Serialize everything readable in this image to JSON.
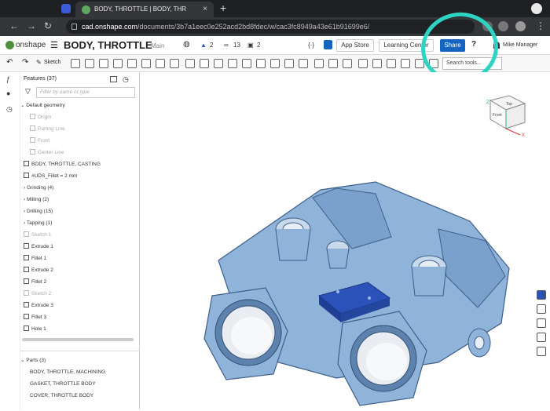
{
  "browser": {
    "tab_title": "BODY, THROTTLE | BODY, THR",
    "tab_close": "×",
    "new_tab": "+",
    "url_host": "cad.onshape.com",
    "url_path": "/documents/3b7a1eec0e252acd2bd8fdec/w/cac3fc8949a43e61b91699e6/"
  },
  "header": {
    "brand": "onshape",
    "doc_title": "BODY, THROTTLE",
    "branch": "Main",
    "likes": "2",
    "links": "13",
    "copies": "2",
    "app_store": "App Store",
    "learning_center": "Learning Center",
    "share": "Share",
    "help": "?",
    "user": "Mike Manager"
  },
  "toolbar": {
    "sketch_label": "Sketch",
    "search_tools": "Search tools..."
  },
  "features": {
    "header": "Features (37)",
    "filter_placeholder": "Filter by name or type",
    "default_geometry": "Default geometry",
    "items": [
      {
        "label": "Origin",
        "state": "dim",
        "indent": 2
      },
      {
        "label": "Parting Line",
        "state": "dim",
        "indent": 2
      },
      {
        "label": "Front",
        "state": "dim",
        "indent": 2
      },
      {
        "label": "Center Line",
        "state": "dim",
        "indent": 2
      },
      {
        "label": "BODY, THROTTLE, CASTING",
        "state": "normal",
        "indent": 0
      },
      {
        "label": "#UDS_Fillet = 2 mm",
        "state": "normal",
        "indent": 0
      },
      {
        "label": "Grinding (4)",
        "state": "folder",
        "indent": 0
      },
      {
        "label": "Milling (2)",
        "state": "folder",
        "indent": 0
      },
      {
        "label": "Drilling (15)",
        "state": "folder",
        "indent": 0
      },
      {
        "label": "Tapping (1)",
        "state": "folder",
        "indent": 0
      },
      {
        "label": "Sketch 1",
        "state": "dim",
        "indent": 0
      },
      {
        "label": "Extrude 1",
        "state": "normal",
        "indent": 0
      },
      {
        "label": "Fillet 1",
        "state": "normal",
        "indent": 0
      },
      {
        "label": "Extrude 2",
        "state": "normal",
        "indent": 0
      },
      {
        "label": "Fillet 2",
        "state": "normal",
        "indent": 0
      },
      {
        "label": "Sketch 2",
        "state": "dim",
        "indent": 0
      },
      {
        "label": "Extrude 3",
        "state": "normal",
        "indent": 0
      },
      {
        "label": "Fillet 3",
        "state": "normal",
        "indent": 0
      },
      {
        "label": "Hole 1",
        "state": "normal",
        "indent": 0
      }
    ],
    "parts_header": "Parts (3)",
    "parts": [
      "BODY, THROTTLE, MACHINING",
      "GASKET, THROTTLE BODY",
      "COVER, THROTTLE BODY"
    ]
  },
  "viewcube": {
    "top": "Top",
    "front": "Front",
    "right": "Right",
    "axis_x": "X",
    "axis_z": "Z"
  },
  "colors": {
    "part_blue": "#8fb3d9",
    "part_dark": "#3d5f8a",
    "cover_blue": "#2b52b8",
    "share_blue": "#1565c0",
    "annotation": "#2fd3c3"
  }
}
